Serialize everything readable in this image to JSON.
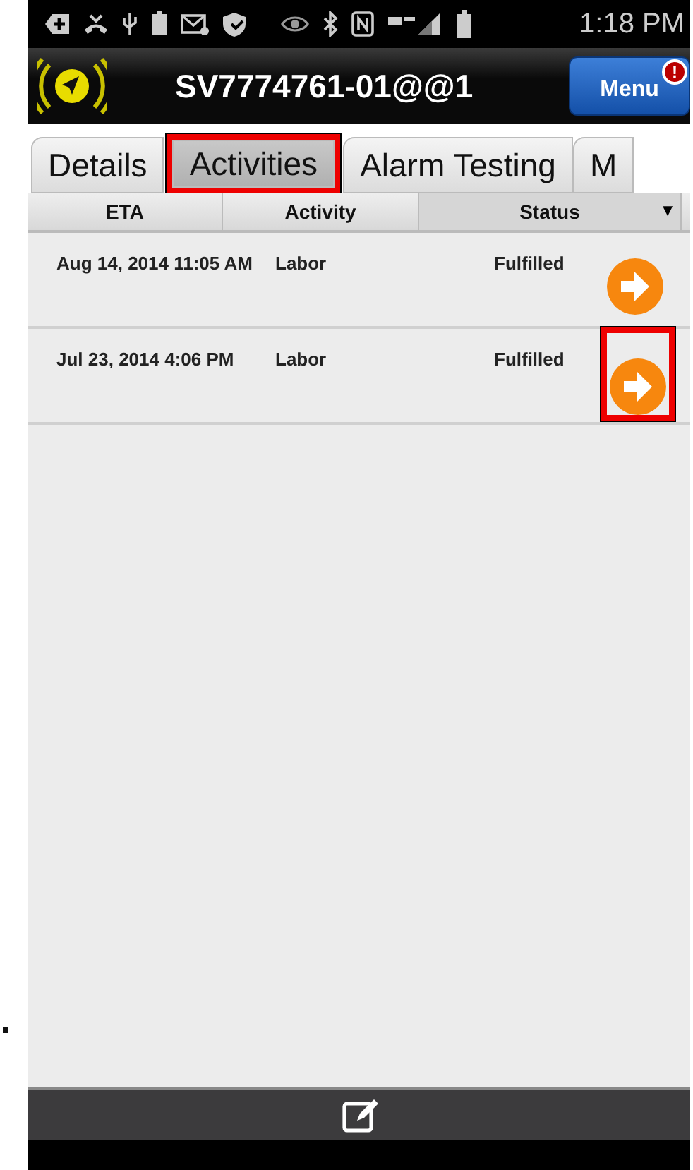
{
  "status_bar": {
    "time": "1:18 PM"
  },
  "header": {
    "title": "SV7774761-01@@1",
    "menu_label": "Menu",
    "menu_badge": "!"
  },
  "tabs": [
    {
      "label": "Details",
      "selected": false,
      "highlighted": false
    },
    {
      "label": "Activities",
      "selected": true,
      "highlighted": true
    },
    {
      "label": "Alarm Testing",
      "selected": false,
      "highlighted": false
    },
    {
      "label": "M",
      "selected": false,
      "highlighted": false
    }
  ],
  "table": {
    "columns": [
      {
        "label": "ETA"
      },
      {
        "label": "Activity"
      },
      {
        "label": "Status"
      }
    ],
    "sort_indicator": "▼",
    "rows": [
      {
        "eta": "Aug 14, 2014 11:05 AM",
        "activity": "Labor",
        "status": "Fulfilled",
        "highlighted": false
      },
      {
        "eta": "Jul 23, 2014 4:06 PM",
        "activity": "Labor",
        "status": "Fulfilled",
        "highlighted": true
      }
    ]
  }
}
